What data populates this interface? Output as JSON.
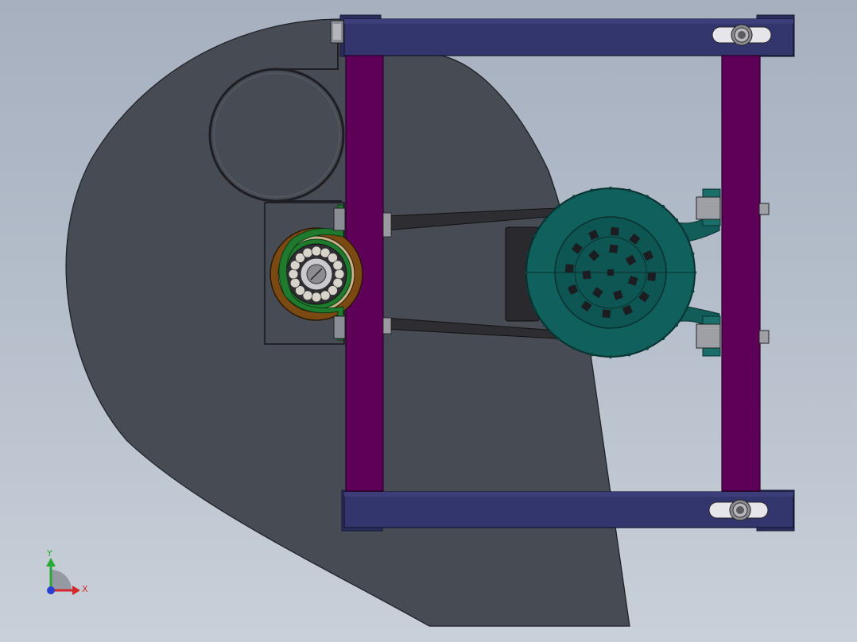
{
  "viewport": {
    "background_top": "#a6b0bf",
    "background_bottom": "#c9d0d9"
  },
  "triad": {
    "x_label": "X",
    "y_label": "Y",
    "x_color": "#d22a2a",
    "y_color": "#2aa838",
    "z_color": "#2a3fd2"
  },
  "colors": {
    "housing": "#474b54",
    "frame_rail": "#33356d",
    "frame_post": "#5e0058",
    "motor": "#10605d",
    "bearing_housing": "#7a4a12",
    "bracket": "#1f7a2e",
    "belt": "#2e2e32"
  },
  "parts": [
    "volute-housing",
    "top-frame-rail",
    "bottom-frame-rail",
    "left-frame-post",
    "right-frame-post",
    "drive-motor",
    "drive-belt",
    "bearing-unit",
    "belt-loop"
  ]
}
